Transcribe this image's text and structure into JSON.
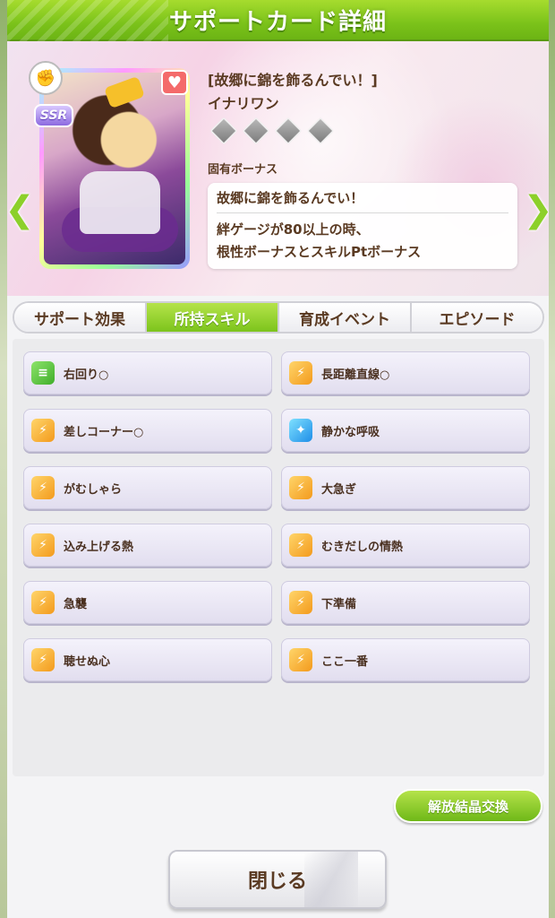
{
  "header": {
    "title": "サポートカード詳細"
  },
  "card": {
    "rarity": "SSR",
    "title": "[故郷に錦を飾るんでい！]",
    "name": "イナリワン",
    "limit_break_level": 0,
    "limit_break_max": 4,
    "favorite": true
  },
  "bonus": {
    "label": "固有ボーナス",
    "name": "故郷に錦を飾るんでい！",
    "description_line1": "絆ゲージが80以上の時、",
    "description_line2": "根性ボーナスとスキルPtボーナス"
  },
  "tabs": [
    {
      "label": "サポート効果",
      "active": false
    },
    {
      "label": "所持スキル",
      "active": true
    },
    {
      "label": "育成イベント",
      "active": false
    },
    {
      "label": "エピソード",
      "active": false
    }
  ],
  "skills": [
    {
      "label": "右回り○",
      "icon": "green"
    },
    {
      "label": "長距離直線○",
      "icon": "orange"
    },
    {
      "label": "差しコーナー○",
      "icon": "orange"
    },
    {
      "label": "静かな呼吸",
      "icon": "blue"
    },
    {
      "label": "がむしゃら",
      "icon": "orange"
    },
    {
      "label": "大急ぎ",
      "icon": "orange"
    },
    {
      "label": "込み上げる熱",
      "icon": "orange"
    },
    {
      "label": "むきだしの情熱",
      "icon": "orange"
    },
    {
      "label": "急襲",
      "icon": "orange"
    },
    {
      "label": "下準備",
      "icon": "orange"
    },
    {
      "label": "聴せぬ心",
      "icon": "orange"
    },
    {
      "label": "ここ一番",
      "icon": "orange"
    }
  ],
  "buttons": {
    "exchange": "解放結晶交換",
    "close": "閉じる"
  },
  "colors": {
    "accent_green": "#7cc41c",
    "text_brown": "#5a3a22"
  }
}
